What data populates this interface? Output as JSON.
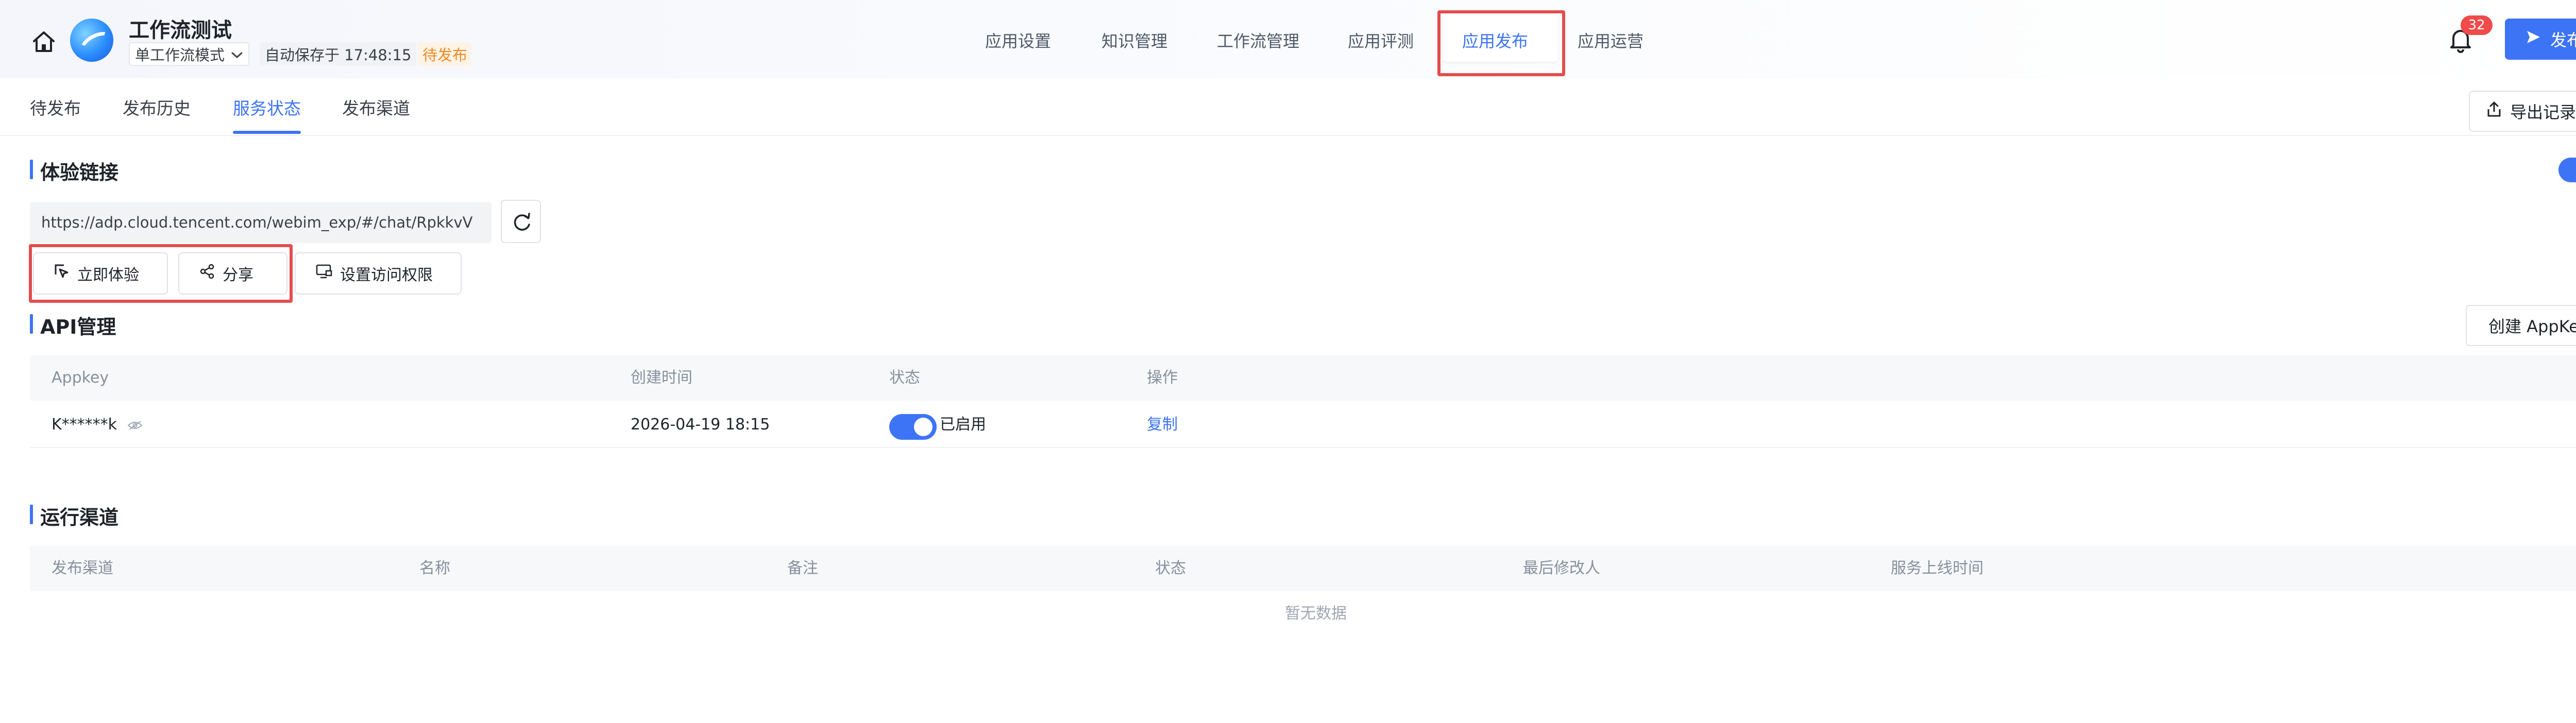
{
  "header": {
    "app_title": "工作流测试",
    "mode_select": "单工作流模式",
    "autosave": "自动保存于 17:48:15",
    "status_badge": "待发布",
    "nav": [
      "应用设置",
      "知识管理",
      "工作流管理",
      "应用评测",
      "应用发布",
      "应用运营"
    ],
    "active_nav": "应用发布",
    "notification_count": "32",
    "publish_label": "发布"
  },
  "sub_tabs": {
    "items": [
      "待发布",
      "发布历史",
      "服务状态",
      "发布渠道"
    ],
    "active": "服务状态",
    "export_label": "导出记录"
  },
  "experience": {
    "title": "体验链接",
    "url": "https://adp.cloud.tencent.com/webim_exp/#/chat/RpkkvV",
    "toggle_on": true,
    "buttons": {
      "try_now": "立即体验",
      "share": "分享",
      "access": "设置访问权限"
    }
  },
  "api": {
    "title": "API管理",
    "create_label": "创建 AppKey",
    "columns": [
      "Appkey",
      "创建时间",
      "状态",
      "操作"
    ],
    "rows": [
      {
        "appkey": "K******k",
        "created": "2026-04-19 18:15",
        "status": "已启用",
        "action": "复制"
      }
    ]
  },
  "channels": {
    "title": "运行渠道",
    "columns": [
      "发布渠道",
      "名称",
      "备注",
      "状态",
      "最后修改人",
      "服务上线时间"
    ],
    "empty_text": "暂无数据"
  },
  "colors": {
    "accent": "#3d74f5",
    "highlight_box": "#e34d4d",
    "pending": "#f08a24",
    "badge": "#f04a4a"
  }
}
